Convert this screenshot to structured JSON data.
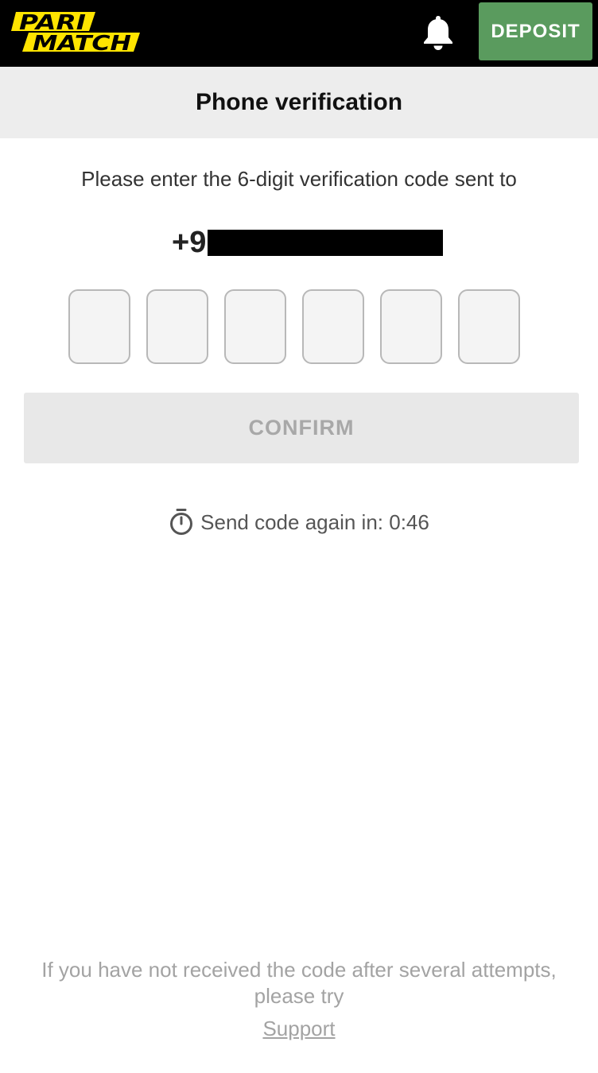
{
  "header": {
    "logo": {
      "line1": "PARI",
      "line2": "MATCH",
      "color": "#ffe400"
    },
    "deposit_label": "DEPOSIT",
    "deposit_color": "#5a9b5e",
    "notification_icon": "bell-icon"
  },
  "title_bar": {
    "title": "Phone verification"
  },
  "verification": {
    "instruction": "Please enter the 6-digit verification code sent to",
    "phone_prefix": "+9",
    "code_length": 6,
    "confirm_label": "CONFIRM",
    "timer_icon": "stopwatch-icon",
    "resend_text": "Send code again in: 0:46"
  },
  "footer": {
    "help_text": "If you have not received the code after several attempts, please try",
    "support_label": "Support"
  }
}
